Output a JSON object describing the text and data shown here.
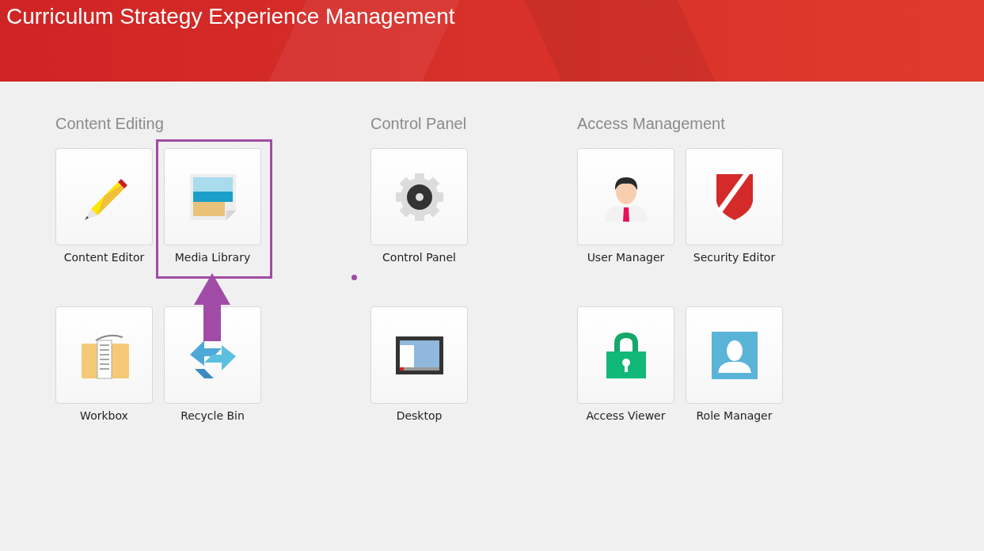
{
  "header": {
    "title": "Curriculum Strategy Experience Management"
  },
  "sections": [
    {
      "heading": "Content Editing",
      "items": [
        {
          "label": "Content Editor",
          "kind": "pencil",
          "highlighted": false
        },
        {
          "label": "Media Library",
          "kind": "picture",
          "highlighted": true
        },
        {
          "label": "Workbox",
          "kind": "workbox",
          "highlighted": false
        },
        {
          "label": "Recycle Bin",
          "kind": "recycle",
          "highlighted": false
        }
      ]
    },
    {
      "heading": "Control Panel",
      "items": [
        {
          "label": "Control Panel",
          "kind": "gear",
          "highlighted": false
        },
        {
          "label": "Desktop",
          "kind": "desktop",
          "highlighted": false
        }
      ]
    },
    {
      "heading": "Access Management",
      "items": [
        {
          "label": "User Manager",
          "kind": "user",
          "highlighted": false
        },
        {
          "label": "Security Editor",
          "kind": "shield",
          "highlighted": false
        },
        {
          "label": "Access Viewer",
          "kind": "lock",
          "highlighted": false
        },
        {
          "label": "Role Manager",
          "kind": "role",
          "highlighted": false
        }
      ]
    }
  ]
}
